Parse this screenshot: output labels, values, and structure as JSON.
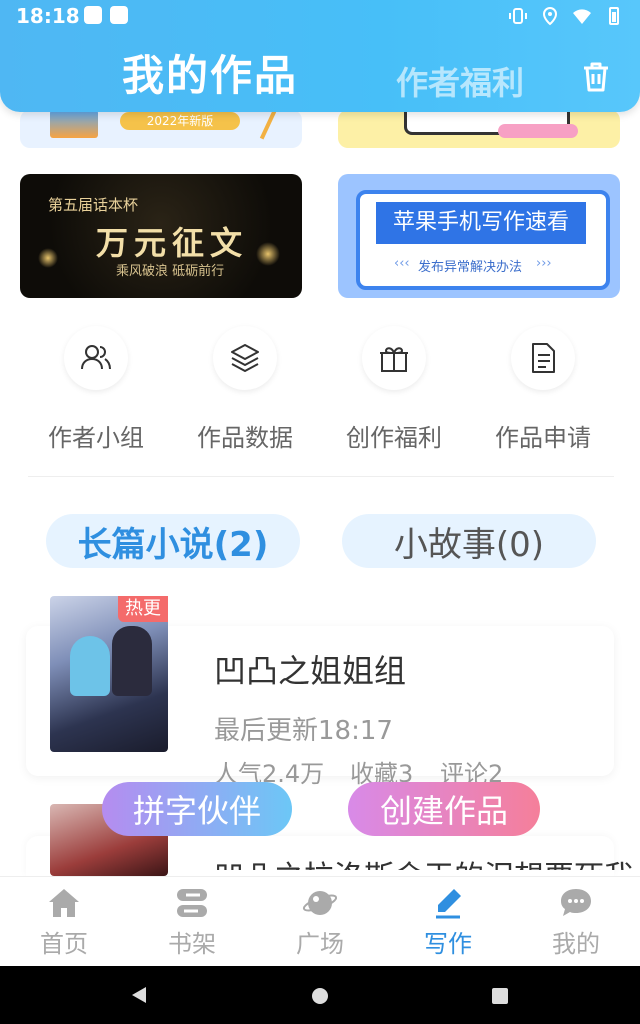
{
  "status_bar": {
    "time": "18:18"
  },
  "header": {
    "title": "我的作品",
    "secondary_tab": "作者福利"
  },
  "banners": {
    "top_left_text": "2022年新版",
    "big_left": {
      "line1": "第五届话本杯",
      "line2": "万元征文",
      "line3": "乘风破浪 砥砺前行"
    },
    "big_right": {
      "title": "苹果手机写作速看",
      "subtitle": "发布异常解决办法"
    }
  },
  "shortcuts": [
    {
      "label": "作者小组",
      "icon": "people-icon"
    },
    {
      "label": "作品数据",
      "icon": "layers-icon"
    },
    {
      "label": "创作福利",
      "icon": "gift-icon"
    },
    {
      "label": "作品申请",
      "icon": "document-icon"
    }
  ],
  "tabs": [
    {
      "label": "长篇小说(2)",
      "active": true
    },
    {
      "label": "小故事(0)",
      "active": false
    }
  ],
  "books": [
    {
      "badge": "热更",
      "title": "凹凸之姐姐组",
      "updated": "最后更新18:17",
      "popularity": "人气2.4万",
      "favorites": "收藏3",
      "comments": "评论2"
    },
    {
      "title": "凹凸之拉洛斯金王的泪想要死我"
    }
  ],
  "floating_buttons": {
    "left": "拼字伙伴",
    "right": "创建作品"
  },
  "bottom_nav": [
    {
      "label": "首页",
      "icon": "home-icon",
      "active": false
    },
    {
      "label": "书架",
      "icon": "bookshelf-icon",
      "active": false
    },
    {
      "label": "广场",
      "icon": "planet-icon",
      "active": false
    },
    {
      "label": "写作",
      "icon": "pen-icon",
      "active": true
    },
    {
      "label": "我的",
      "icon": "chat-bubble-icon",
      "active": false
    }
  ],
  "colors": {
    "accent": "#2f8fe0",
    "header": "#4fb7f3",
    "hot_badge": "#f46b6b"
  }
}
